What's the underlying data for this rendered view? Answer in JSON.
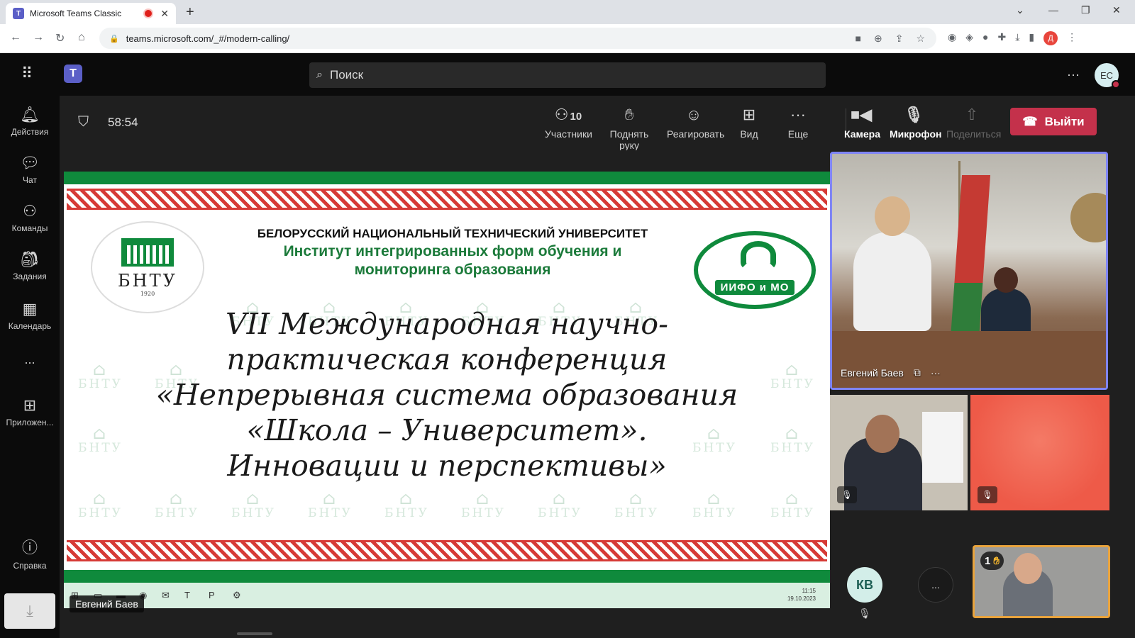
{
  "browser": {
    "tab_title": "Microsoft Teams Classic",
    "url": "teams.microsoft.com/_#/modern-calling/",
    "profile_letter": "Д"
  },
  "teams": {
    "search_placeholder": "Поиск",
    "user_initials": "EC"
  },
  "rail": {
    "items": [
      {
        "label": "Действия",
        "icon": "bell-icon"
      },
      {
        "label": "Чат",
        "icon": "chat-icon"
      },
      {
        "label": "Команды",
        "icon": "teams-icon"
      },
      {
        "label": "Задания",
        "icon": "assignments-icon"
      },
      {
        "label": "Календарь",
        "icon": "calendar-icon"
      },
      {
        "label": "...",
        "icon": "more-icon"
      },
      {
        "label": "Приложен...",
        "icon": "apps-icon"
      },
      {
        "label": "Справка",
        "icon": "help-icon"
      }
    ]
  },
  "meeting": {
    "timer": "58:54",
    "participants_count": "10",
    "participants_label": "Участники",
    "raise_hand_label": "Поднять руку",
    "react_label": "Реагировать",
    "view_label": "Вид",
    "more_label": "Еще",
    "camera_label": "Камера",
    "mic_label": "Микрофон",
    "share_label": "Поделиться",
    "leave_label": "Выйти"
  },
  "slide": {
    "university": "БЕЛОРУССКИЙ НАЦИОНАЛЬНЫЙ ТЕХНИЧЕСКИЙ УНИВЕРСИТЕТ",
    "institute_line1": "Институт интегрированных форм обучения и",
    "institute_line2": "мониторинга образования",
    "logo_left": "БНТУ",
    "logo_left_year": "1920",
    "logo_right": "ИИФО и МО",
    "title_line1": "VII Международная научно-",
    "title_line2": "практическая конференция",
    "title_line3": "«Непрерывная система образования",
    "title_line4": "«Школа – Университет».",
    "title_line5": "Инновации и перспективы»",
    "watermark": "БНТУ",
    "clock_time": "11:15",
    "clock_date": "19.10.2023"
  },
  "participants": {
    "sharer_name": "Евгений Баев",
    "main_tile_name": "Евгений Баев",
    "avatar_initials": "КВ",
    "more_tiles": "...",
    "raised_hands": "1"
  },
  "colors": {
    "accent": "#7f85f5",
    "leave": "#c4314b",
    "hand_border": "#e8a33d",
    "slide_green": "#0f8a3c",
    "ornament_red": "#d32a25"
  }
}
